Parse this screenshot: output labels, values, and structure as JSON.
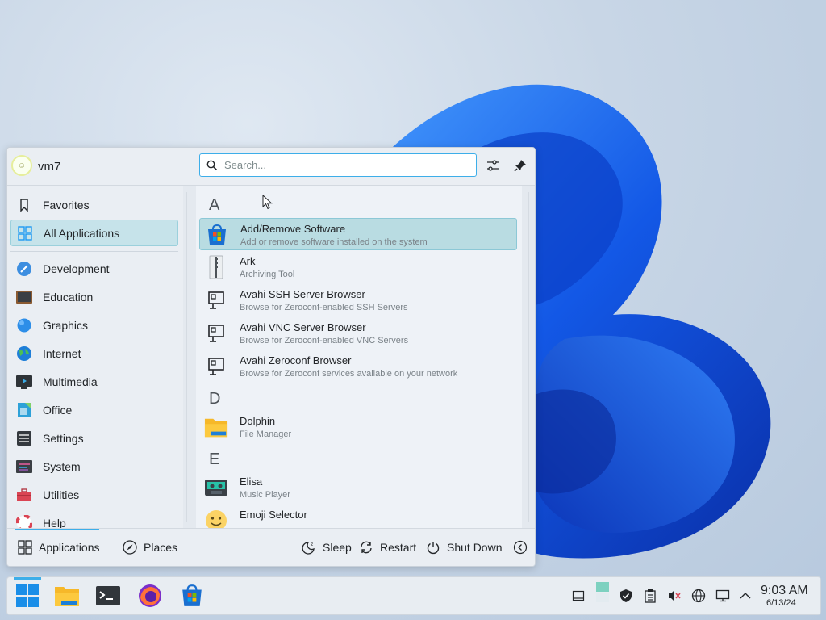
{
  "user": {
    "name": "vm7"
  },
  "search": {
    "placeholder": "Search..."
  },
  "sidebar": {
    "items": [
      {
        "label": "Favorites"
      },
      {
        "label": "All Applications"
      },
      {
        "label": "Development"
      },
      {
        "label": "Education"
      },
      {
        "label": "Graphics"
      },
      {
        "label": "Internet"
      },
      {
        "label": "Multimedia"
      },
      {
        "label": "Office"
      },
      {
        "label": "Settings"
      },
      {
        "label": "System"
      },
      {
        "label": "Utilities"
      },
      {
        "label": "Help"
      }
    ]
  },
  "applist": {
    "letters": [
      "A",
      "D",
      "E"
    ],
    "apps": [
      {
        "name": "Add/Remove Software",
        "desc": "Add or remove software installed on the system"
      },
      {
        "name": "Ark",
        "desc": "Archiving Tool"
      },
      {
        "name": "Avahi SSH Server Browser",
        "desc": "Browse for Zeroconf-enabled SSH Servers"
      },
      {
        "name": "Avahi VNC Server Browser",
        "desc": "Browse for Zeroconf-enabled VNC Servers"
      },
      {
        "name": "Avahi Zeroconf Browser",
        "desc": "Browse for Zeroconf services available on your network"
      },
      {
        "name": "Dolphin",
        "desc": "File Manager"
      },
      {
        "name": "Elisa",
        "desc": "Music Player"
      },
      {
        "name": "Emoji Selector",
        "desc": ""
      }
    ]
  },
  "footer": {
    "applications": "Applications",
    "places": "Places",
    "sleep": "Sleep",
    "restart": "Restart",
    "shutdown": "Shut Down"
  },
  "clock": {
    "time": "9:03 AM",
    "date": "6/13/24"
  },
  "colors": {
    "accent": "#3daee9",
    "selection": "#b9dce2"
  }
}
